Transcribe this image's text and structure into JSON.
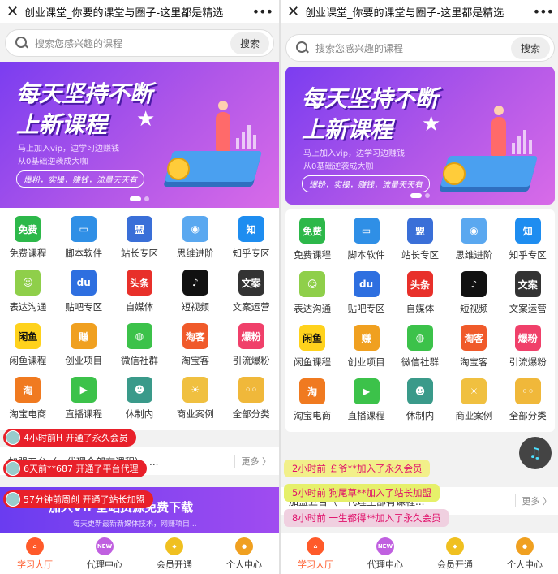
{
  "title": "创业课堂_你要的课堂与圈子-这里都是精选",
  "search": {
    "placeholder": "搜索您感兴趣的课程",
    "button": "搜索"
  },
  "banner": {
    "line1": "每天坚持不断",
    "line2": "上新课程",
    "sub1": "马上加入vip，边学习边赚钱",
    "sub2": "从0基础逆袭成大咖",
    "pill": "爆粉，实操，赚钱，流量天天有"
  },
  "grid": [
    {
      "label": "免费课程",
      "icon": "免费",
      "color": "#2db84a"
    },
    {
      "label": "脚本软件",
      "icon": "▭",
      "color": "#2f8fe6"
    },
    {
      "label": "站长专区",
      "icon": "盟",
      "color": "#3a6fd8"
    },
    {
      "label": "思维进阶",
      "icon": "◉",
      "color": "#5aa8f0"
    },
    {
      "label": "知乎专区",
      "icon": "知",
      "color": "#1e8df0"
    },
    {
      "label": "表达沟通",
      "icon": "☺",
      "color": "#8fcf4a"
    },
    {
      "label": "贴吧专区",
      "icon": "du",
      "color": "#2e6fe0"
    },
    {
      "label": "自媒体",
      "icon": "头条",
      "color": "#e8302a"
    },
    {
      "label": "短视频",
      "icon": "♪",
      "color": "#111111"
    },
    {
      "label": "文案运营",
      "icon": "文案",
      "color": "#333333"
    },
    {
      "label": "闲鱼课程",
      "icon": "闲鱼",
      "color": "#ffd21c"
    },
    {
      "label": "创业项目",
      "icon": "赚",
      "color": "#f0a020"
    },
    {
      "label": "微信社群",
      "icon": "◍",
      "color": "#3cc24a"
    },
    {
      "label": "淘宝客",
      "icon": "淘客",
      "color": "#f05a2a"
    },
    {
      "label": "引流爆粉",
      "icon": "爆粉",
      "color": "#f0406a"
    },
    {
      "label": "淘宝电商",
      "icon": "淘",
      "color": "#f07a20"
    },
    {
      "label": "直播课程",
      "icon": "▶",
      "color": "#3cc24a"
    },
    {
      "label": "休制内",
      "icon": "☻",
      "color": "#3a9a8a"
    },
    {
      "label": "商业案例",
      "icon": "☀",
      "color": "#f0c040"
    },
    {
      "label": "全部分类",
      "icon": "◦◦",
      "color": "#f0b83a"
    }
  ],
  "news": {
    "text": "加盟五台（一代理全部有课程），...",
    "more": "更多 〉"
  },
  "news_right": {
    "text": "加盟五台（一代理全部有课程...",
    "more": "更多 〉"
  },
  "promo": {
    "title": "加入VIP全站资源免费下载",
    "sub": "每天更新最新新媒体技术，网赚项目..."
  },
  "tabs": [
    {
      "label": "学习大厅",
      "icon": "⌂",
      "color": "#ff5a2a"
    },
    {
      "label": "代理中心",
      "icon": "NEW",
      "color": "#c060e0"
    },
    {
      "label": "会员开通",
      "icon": "◆",
      "color": "#f0c020"
    },
    {
      "label": "个人中心",
      "icon": "●",
      "color": "#f0a020"
    }
  ],
  "left_toasts": [
    "4小时前H 开通了永久会员",
    "6天前**687 开通了平台代理",
    "57分钟前周创 开通了站长加盟"
  ],
  "right_toasts": [
    {
      "text": "2小时前 ￡爷**加入了永久会员",
      "bg": "#f2f08a"
    },
    {
      "text": "5小时前 狗尾草**加入了站长加盟",
      "bg": "#e6f06a"
    },
    {
      "text": "8小时前 一生都得**加入了永久会员",
      "bg": "#f0d0e0"
    }
  ]
}
